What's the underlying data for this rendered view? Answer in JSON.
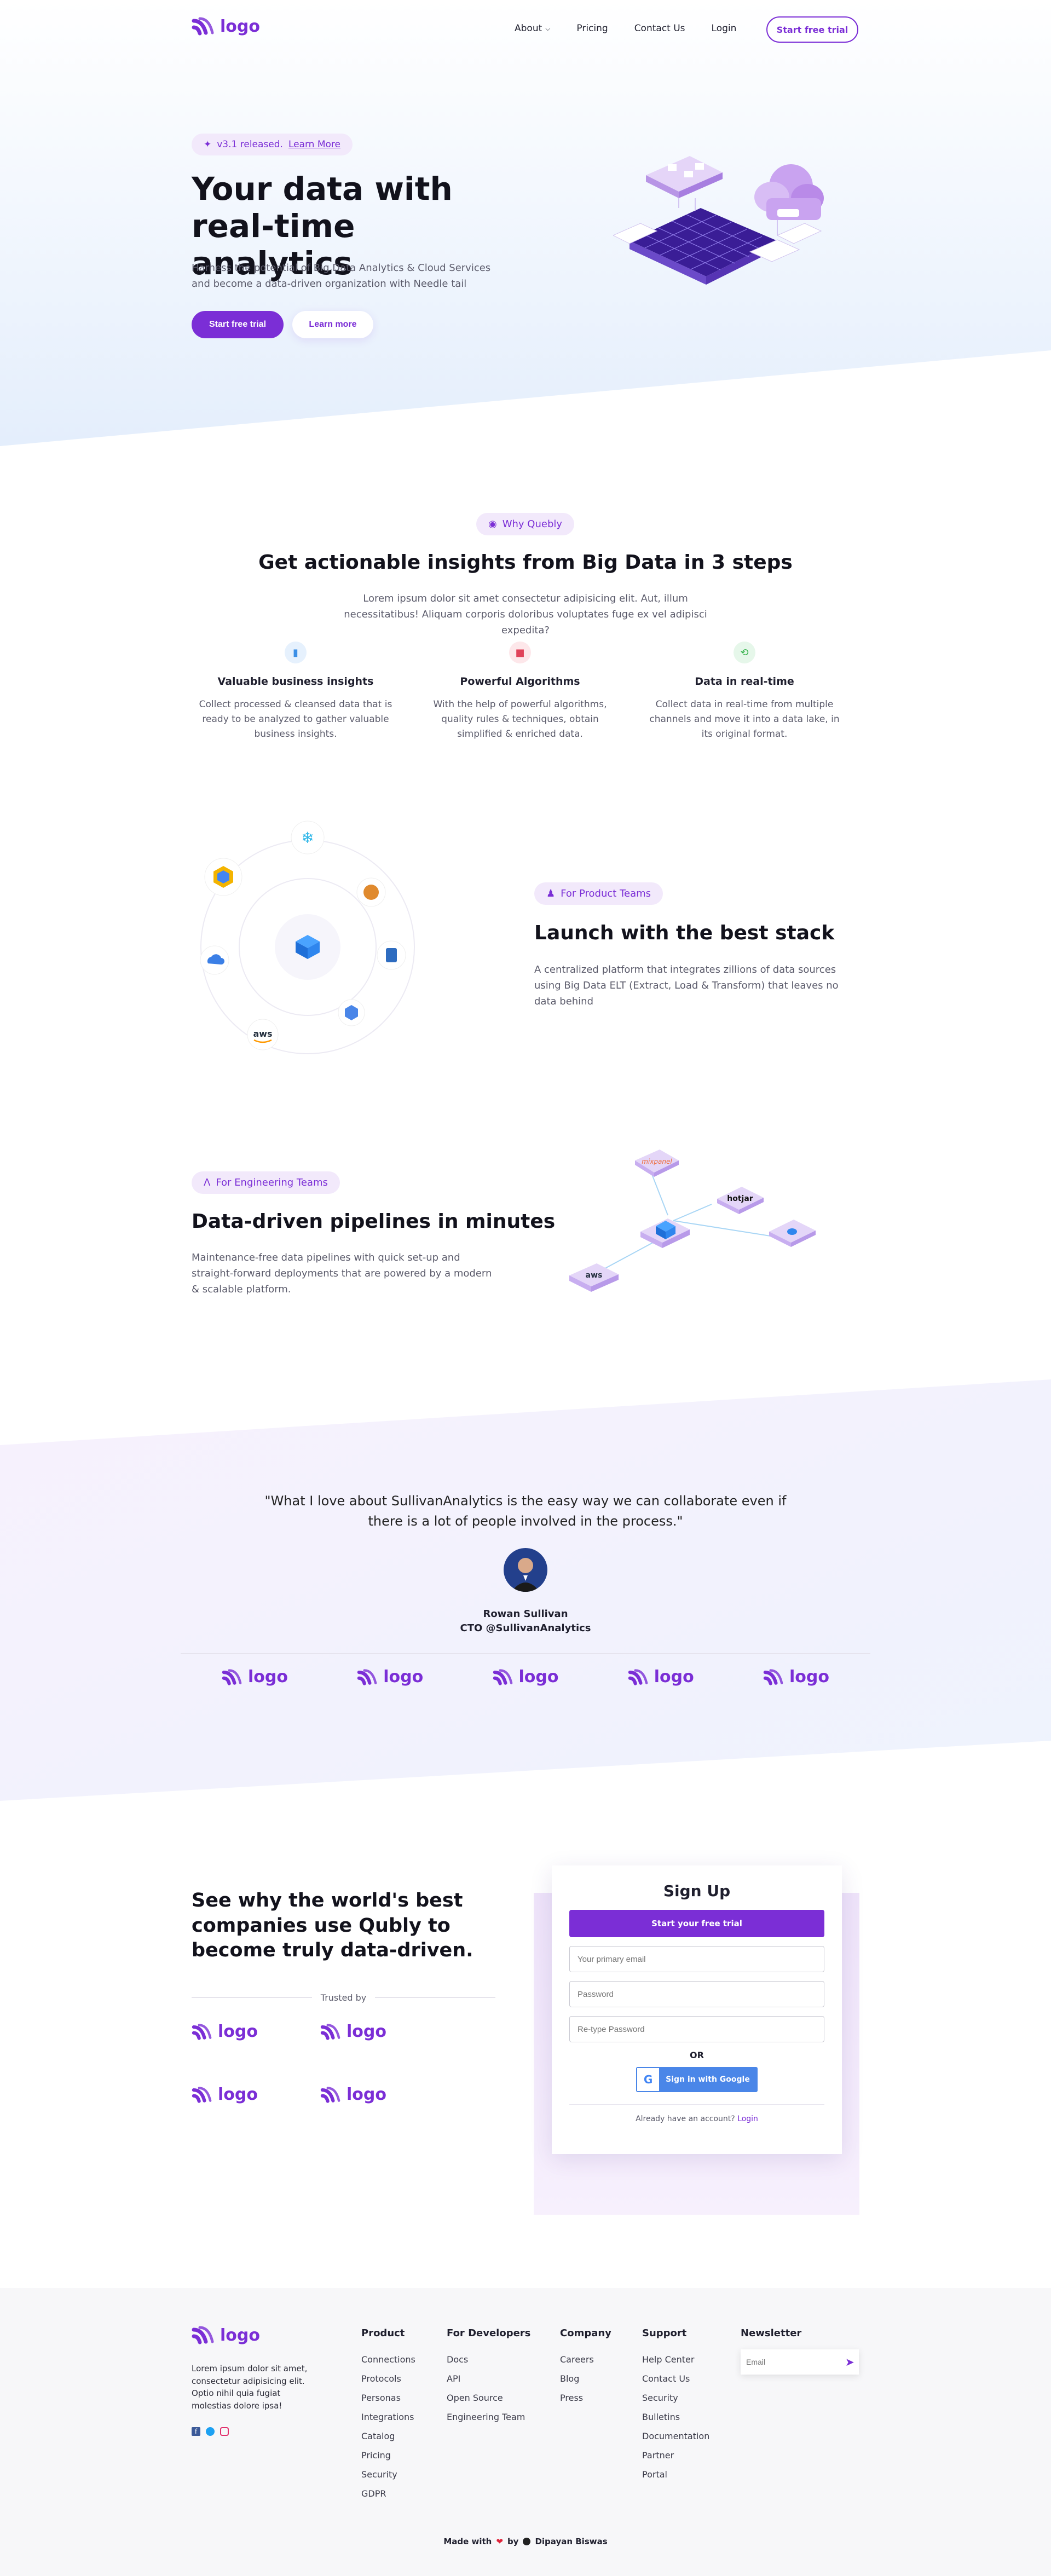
{
  "colors": {
    "accent": "#7b2ed6",
    "hero_bg": "#eaf2fd",
    "soft": "#f2e9fb",
    "google_blue": "#4a86e8"
  },
  "nav": {
    "brand": "logo",
    "items": [
      {
        "label": "About"
      },
      {
        "label": "Pricing"
      },
      {
        "label": "Contact Us"
      },
      {
        "label": "Login"
      }
    ],
    "cta": "Start free trial"
  },
  "hero": {
    "pill_text": "v3.1 released.",
    "pill_link": "Learn More",
    "title": "Your data with real-time analytics",
    "subtitle": "Harness the potential of Big Data Analytics & Cloud Services and become a data-driven organization with Needle tail",
    "primary_cta": "Start free trial",
    "secondary_cta": "Learn more"
  },
  "why": {
    "pill": "Why Quebly",
    "title": "Get actionable insights from Big Data in 3 steps",
    "subtitle": "Lorem ipsum dolor sit amet consectetur adipisicing elit. Aut, illum necessitatibus! Aliquam corporis doloribus voluptates fuge ex vel adipisci expedita?",
    "features": [
      {
        "title": "Valuable business insights",
        "text": "Collect processed & cleansed data that is ready to be analyzed to gather valuable business insights.",
        "icon": "bar-chart-icon",
        "color": "#3b8fe6",
        "bg": "#e6f1fd"
      },
      {
        "title": "Powerful Algorithms",
        "text": "With the help of powerful algorithms, quality rules & techniques, obtain simplified & enriched data.",
        "icon": "algorithm-icon",
        "color": "#e0435a",
        "bg": "#fde7ea"
      },
      {
        "title": "Data in real-time",
        "text": "Collect data in real-time from multiple channels and move it into a data lake, in its original format.",
        "icon": "share-icon",
        "color": "#37b24d",
        "bg": "#e6f7ea"
      }
    ]
  },
  "product": {
    "pill": "For Product Teams",
    "title": "Launch with the best stack",
    "text": "A centralized platform that integrates zillions of data sources using Big Data ELT (Extract, Load & Transform) that leaves no data behind",
    "aws_label": "aws"
  },
  "engineering": {
    "pill": "For Engineering Teams",
    "title": "Data-driven pipelines in minutes",
    "text": "Maintenance-free data pipelines with quick set-up and straight-forward deployments that are powered by a modern & scalable platform.",
    "tiles": [
      "mixpanel",
      "hotjar",
      "aws"
    ]
  },
  "testimonial": {
    "quote": "\"What I love about SullivanAnalytics is the easy way we can collaborate even if there is a lot of people involved in the process.\"",
    "name": "Rowan Sullivan",
    "role": "CTO @SullivanAnalytics",
    "logos": [
      "logo",
      "logo",
      "logo",
      "logo",
      "logo"
    ]
  },
  "signup_section": {
    "headline": "See why the world's best companies use Qubly to become truly data-driven.",
    "trusted_by": "Trusted by",
    "logos": [
      "logo",
      "logo",
      "logo",
      "logo"
    ],
    "form": {
      "title": "Sign Up",
      "cta": "Start your free trial",
      "email_placeholder": "Your primary email",
      "password_placeholder": "Password",
      "retype_placeholder": "Re-type Password",
      "or": "OR",
      "google": "Sign in with Google",
      "already": "Already have an account?",
      "login": "Login"
    }
  },
  "footer": {
    "brand": "logo",
    "about": "Lorem ipsum dolor sit amet, consectetur adipisicing elit. Optio nihil quia fugiat molestias dolore ipsa!",
    "columns": [
      {
        "title": "Product",
        "links": [
          "Connections",
          "Protocols",
          "Personas",
          "Integrations",
          "Catalog",
          "Pricing",
          "Security",
          "GDPR"
        ]
      },
      {
        "title": "For Developers",
        "links": [
          "Docs",
          "API",
          "Open Source",
          "Engineering Team"
        ]
      },
      {
        "title": "Company",
        "links": [
          "Careers",
          "Blog",
          "Press"
        ]
      },
      {
        "title": "Support",
        "links": [
          "Help Center",
          "Contact Us",
          "Security",
          "Bulletins",
          "Documentation",
          "Partner",
          "Portal"
        ]
      }
    ],
    "newsletter_title": "Newsletter",
    "newsletter_placeholder": "Email",
    "made_with": "Made with",
    "by": "by",
    "author": "Dipayan Biswas"
  }
}
